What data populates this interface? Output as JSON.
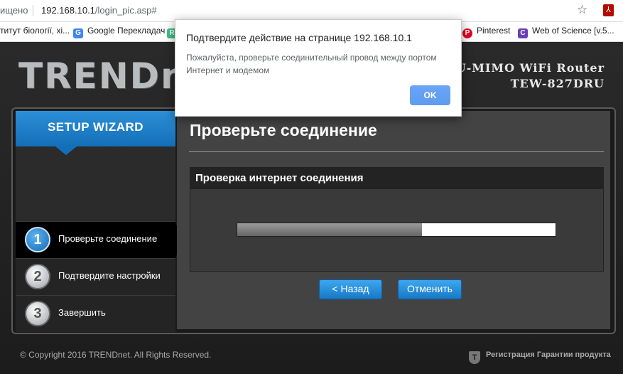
{
  "browser": {
    "security_text": "ищено",
    "url_host": "192.168.10.1",
    "url_path": "/login_pic.asp#",
    "bookmarks": [
      {
        "label": "титут біології, хі..."
      },
      {
        "label": "Google Перекладач"
      },
      {
        "label": "R"
      },
      {
        "label": "Pinterest"
      },
      {
        "label": "Web of Science [v.5..."
      }
    ]
  },
  "router": {
    "logo_text": "TRENDnet",
    "model_line1": "MU-MIMO WiFi Router",
    "model_line2": "TEW-827DRU",
    "wizard_title": "SETUP WIZARD",
    "steps": [
      {
        "number": "1",
        "label": "Проверьте соединение",
        "active": true
      },
      {
        "number": "2",
        "label": "Подтвердите настройки",
        "active": false
      },
      {
        "number": "3",
        "label": "Завершить",
        "active": false
      }
    ],
    "content_title": "Проверьте соединение",
    "panel_title": "Проверка интернет соединения",
    "progress_fraction": 0.58,
    "back_button": "< Назад",
    "cancel_button": "Отменить",
    "copyright": "© Copyright 2016 TRENDnet. All Rights Reserved.",
    "warranty_link": "Регистрация Гарантии продукта"
  },
  "dialog": {
    "title": "Подтвердите действие на странице 192.168.10.1",
    "message": "Пожалуйста, проверьте соединительный провод между портом Интернет и модемом",
    "ok_button": "OK"
  }
}
